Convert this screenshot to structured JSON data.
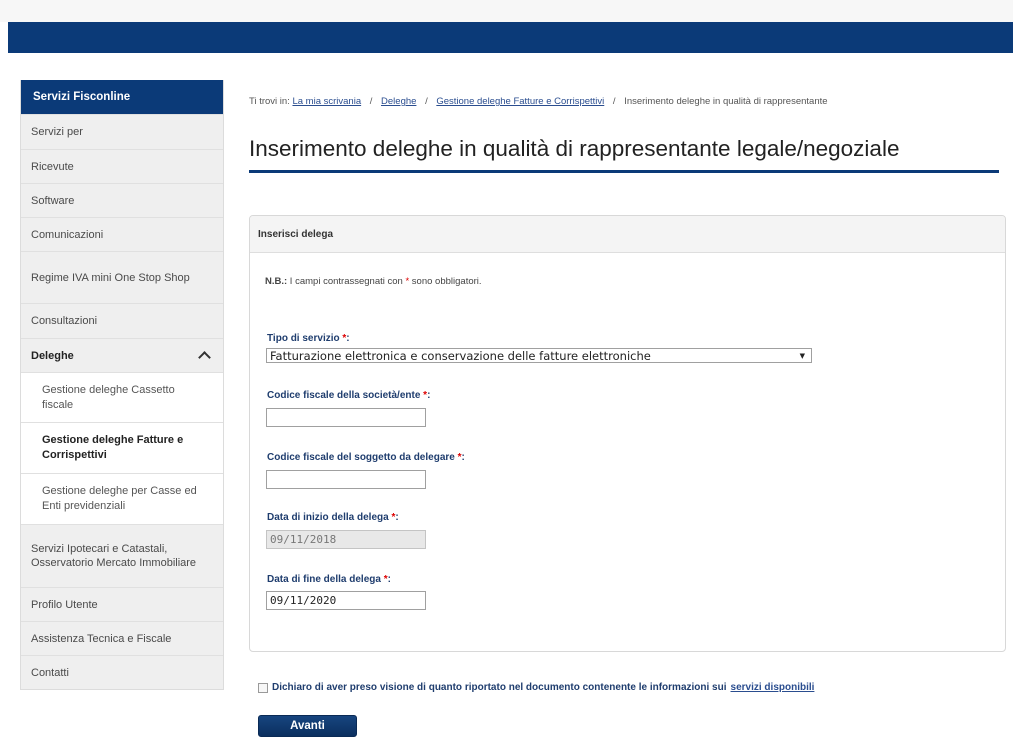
{
  "sidebar": {
    "header": "Servizi Fisconline",
    "items_top": [
      "Servizi per",
      "Ricevute",
      "Software",
      "Comunicazioni",
      "Regime IVA mini One Stop Shop",
      "Consultazioni"
    ],
    "deleghe": "Deleghe",
    "sub_items": [
      "Gestione deleghe Cassetto fiscale",
      "Gestione deleghe Fatture e Corrispettivi",
      "Gestione deleghe per Casse ed Enti previdenziali"
    ],
    "items_bottom": [
      "Servizi Ipotecari e Catastali, Osservatorio Mercato Immobiliare",
      "Profilo Utente",
      "Assistenza Tecnica e Fiscale",
      "Contatti"
    ]
  },
  "breadcrumb": {
    "prefix": "Ti trovi in:",
    "links": [
      "La mia scrivania",
      "Deleghe",
      "Gestione deleghe Fatture e Corrispettivi"
    ],
    "current": "Inserimento deleghe in qualità di rappresentante",
    "separator": "/"
  },
  "page_title": "Inserimento deleghe in qualità di rappresentante legale/negoziale",
  "form": {
    "panel_title": "Inserisci delega",
    "note_bold": "N.B.:",
    "note_text": " I campi contrassegnati con ",
    "note_star": "*",
    "note_end": " sono obbligatori.",
    "req_mark": " *",
    "colon": ":",
    "tipo_label": "Tipo di servizio",
    "tipo_value": "Fatturazione elettronica e conservazione delle fatture elettroniche",
    "select_arrow": "▼",
    "cf_societa_label": "Codice fiscale della società/ente",
    "cf_societa_value": "",
    "cf_soggetto_label": "Codice fiscale del soggetto da delegare",
    "cf_soggetto_value": "",
    "data_inizio_label": "Data di inizio della delega",
    "data_inizio_value": "09/11/2018",
    "data_fine_label": "Data di fine della delega",
    "data_fine_value": "09/11/2020"
  },
  "declaration": {
    "text": "Dichiaro di aver preso visione di quanto riportato nel documento contenente le informazioni sui",
    "link": "servizi disponibili"
  },
  "button_label": "Avanti",
  "colors": {
    "brand_blue": "#0b3a78",
    "label_blue": "#1f3d6e",
    "required_red": "#dd0000"
  }
}
